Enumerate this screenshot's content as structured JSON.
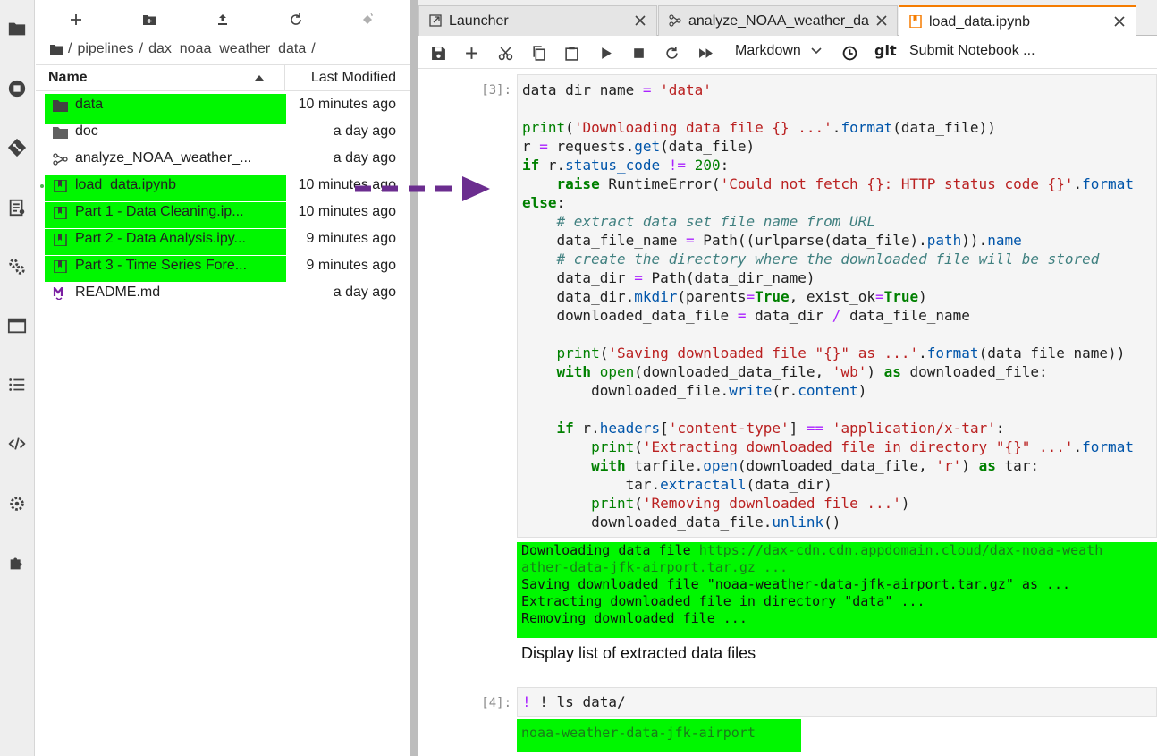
{
  "file_browser": {
    "breadcrumb": {
      "root": "/",
      "segments": [
        "pipelines",
        "dax_noaa_weather_data"
      ],
      "trailing": "/"
    },
    "columns": {
      "name": "Name",
      "modified": "Last Modified"
    },
    "files": [
      {
        "name": "data",
        "modified": "10 minutes ago",
        "kind": "folder-icon",
        "highlighted": true
      },
      {
        "name": "doc",
        "modified": "a day ago",
        "kind": "folder-icon",
        "highlighted": false
      },
      {
        "name": "analyze_NOAA_weather_...",
        "modified": "a day ago",
        "kind": "pipeline-icon",
        "highlighted": false
      },
      {
        "name": "load_data.ipynb",
        "modified": "10 minutes ago",
        "kind": "notebook-icon",
        "highlighted": true
      },
      {
        "name": "Part 1 - Data Cleaning.ip...",
        "modified": "10 minutes ago",
        "kind": "notebook-icon",
        "highlighted": true
      },
      {
        "name": "Part 2 - Data Analysis.ipy...",
        "modified": "9 minutes ago",
        "kind": "notebook-icon",
        "highlighted": true
      },
      {
        "name": "Part 3 - Time Series Fore...",
        "modified": "9 minutes ago",
        "kind": "notebook-icon",
        "highlighted": true
      },
      {
        "name": "README.md",
        "modified": "a day ago",
        "kind": "markdown-icon",
        "highlighted": false
      }
    ]
  },
  "tabs": [
    {
      "label": "Launcher",
      "icon": "launcher-icon",
      "active": false
    },
    {
      "label": "analyze_NOAA_weather_da",
      "icon": "pipeline-icon",
      "active": false
    },
    {
      "label": "load_data.ipynb",
      "icon": "notebook-icon",
      "active": true
    }
  ],
  "notebook_toolbar": {
    "cell_type": "Markdown",
    "git_label": "git",
    "submit_label": "Submit Notebook ..."
  },
  "cells": {
    "cell3": {
      "prompt": "[3]:",
      "output_lines": [
        "Downloading data file ",
        "https://dax-cdn.cdn.appdomain.cloud/dax-noaa-weath",
        "ather-data-jfk-airport.tar.gz ...",
        "Saving downloaded file \"noaa-weather-data-jfk-airport.tar.gz\" as ...",
        "Extracting downloaded file in directory \"data\" ...",
        "Removing downloaded file ..."
      ]
    },
    "markdown": "Display list of extracted data files",
    "cell4": {
      "prompt": "[4]:",
      "code": "! ls data/",
      "output": "noaa-weather-data-jfk-airport"
    }
  },
  "colors": {
    "highlight": "#00f700",
    "active_tab_accent": "#f57c00",
    "annotation_arrow": "#6b2d8f"
  }
}
